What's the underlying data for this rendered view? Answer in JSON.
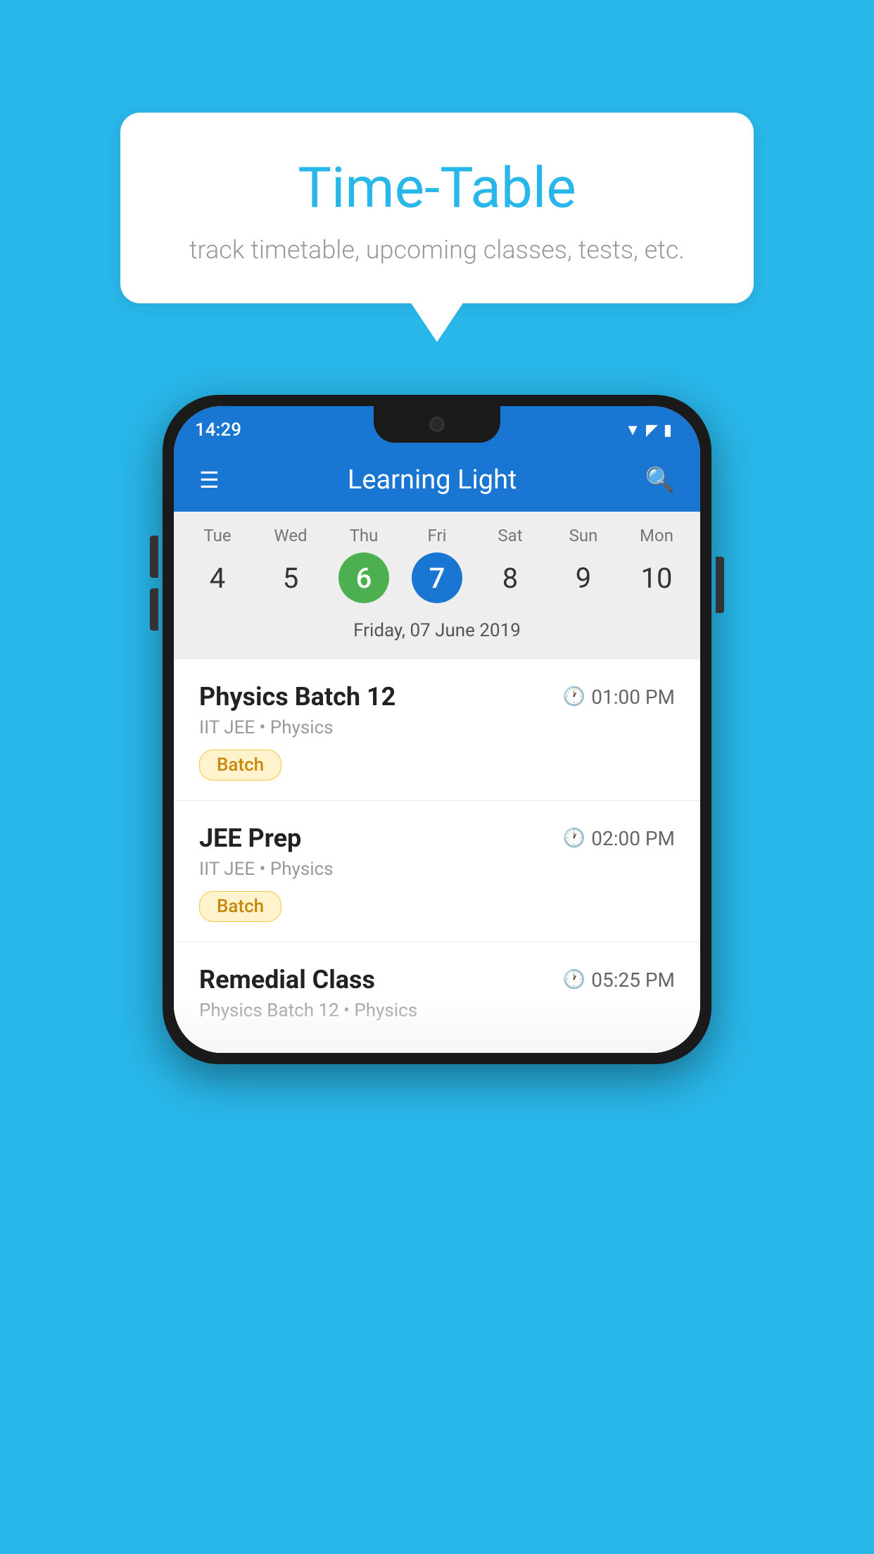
{
  "background": {
    "color": "#29B6E8"
  },
  "tooltip": {
    "title": "Time-Table",
    "subtitle": "track timetable, upcoming classes, tests, etc."
  },
  "phone": {
    "status_bar": {
      "time": "14:29"
    },
    "app_bar": {
      "title": "Learning Light"
    },
    "calendar": {
      "days": [
        {
          "name": "Tue",
          "number": "4",
          "state": "normal"
        },
        {
          "name": "Wed",
          "number": "5",
          "state": "normal"
        },
        {
          "name": "Thu",
          "number": "6",
          "state": "today"
        },
        {
          "name": "Fri",
          "number": "7",
          "state": "selected"
        },
        {
          "name": "Sat",
          "number": "8",
          "state": "normal"
        },
        {
          "name": "Sun",
          "number": "9",
          "state": "normal"
        },
        {
          "name": "Mon",
          "number": "10",
          "state": "normal"
        }
      ],
      "selected_date_label": "Friday, 07 June 2019"
    },
    "classes": [
      {
        "name": "Physics Batch 12",
        "time": "01:00 PM",
        "subject": "IIT JEE • Physics",
        "badge": "Batch"
      },
      {
        "name": "JEE Prep",
        "time": "02:00 PM",
        "subject": "IIT JEE • Physics",
        "badge": "Batch"
      },
      {
        "name": "Remedial Class",
        "time": "05:25 PM",
        "subject": "Physics Batch 12 • Physics",
        "badge": null
      }
    ]
  }
}
